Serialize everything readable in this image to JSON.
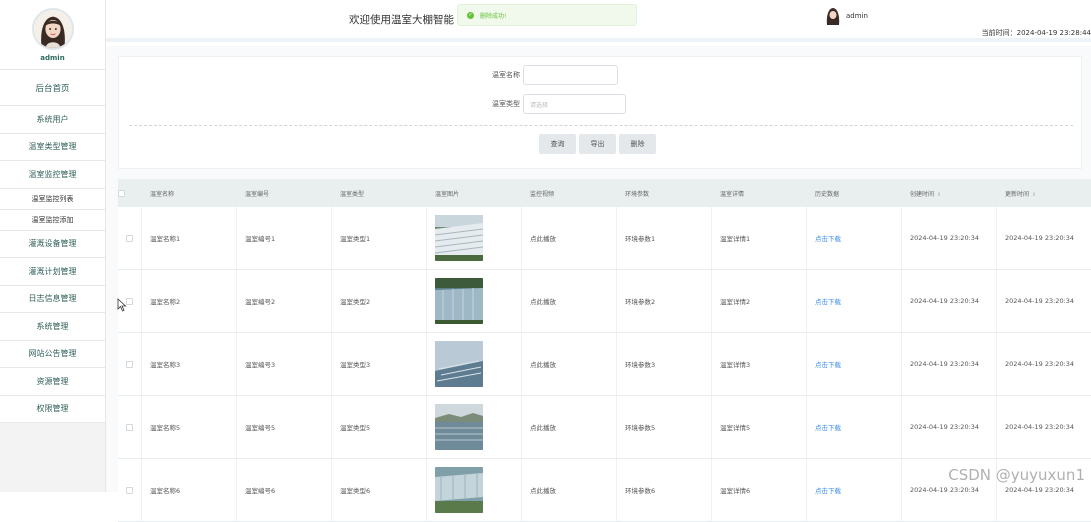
{
  "sidebar": {
    "user_name": "admin",
    "items": [
      {
        "label": "后台首页"
      },
      {
        "label": "系统用户"
      },
      {
        "label": "温室类型管理"
      },
      {
        "label": "温室监控管理"
      },
      {
        "label": "温室监控列表"
      },
      {
        "label": "温室监控添加"
      },
      {
        "label": "灌溉设备管理"
      },
      {
        "label": "灌溉计划管理"
      },
      {
        "label": "日志信息管理"
      },
      {
        "label": "系统管理"
      },
      {
        "label": "网站公告管理"
      },
      {
        "label": "资源管理"
      },
      {
        "label": "权限管理"
      }
    ]
  },
  "header": {
    "welcome": "欢迎使用温室大棚智能",
    "toast": "删除成功!",
    "user_name": "admin",
    "clock": "当前时间：2024-04-19 23:28:44"
  },
  "search": {
    "name_label": "温室名称",
    "name_value": "",
    "type_label": "温室类型",
    "type_placeholder": "请选择",
    "query_button": "查询",
    "export_button": "导出",
    "delete_button": "删除"
  },
  "table": {
    "headers": [
      "温室名称",
      "温室编号",
      "温室类型",
      "温室图片",
      "监控视频",
      "环境参数",
      "温室详情",
      "历史数据",
      "创建时间",
      "更新时间"
    ],
    "rows": [
      {
        "name": "温室名称1",
        "code": "温室编号1",
        "type": "温室类型1",
        "video": "点此播放",
        "env": "环境参数1",
        "detail": "温室详情1",
        "history": "点击下载",
        "created": "2024-04-19 23:20:34",
        "updated": "2024-04-19 23:20:34"
      },
      {
        "name": "温室名称2",
        "code": "温室编号2",
        "type": "温室类型2",
        "video": "点此播放",
        "env": "环境参数2",
        "detail": "温室详情2",
        "history": "点击下载",
        "created": "2024-04-19 23:20:34",
        "updated": "2024-04-19 23:20:34"
      },
      {
        "name": "温室名称3",
        "code": "温室编号3",
        "type": "温室类型3",
        "video": "点此播放",
        "env": "环境参数3",
        "detail": "温室详情3",
        "history": "点击下载",
        "created": "2024-04-19 23:20:34",
        "updated": "2024-04-19 23:20:34"
      },
      {
        "name": "温室名称5",
        "code": "温室编号5",
        "type": "温室类型5",
        "video": "点此播放",
        "env": "环境参数5",
        "detail": "温室详情5",
        "history": "点击下载",
        "created": "2024-04-19 23:20:34",
        "updated": "2024-04-19 23:20:34"
      },
      {
        "name": "温室名称6",
        "code": "温室编号6",
        "type": "温室类型6",
        "video": "点此播放",
        "env": "环境参数6",
        "detail": "温室详情6",
        "history": "点击下载",
        "created": "2024-04-19 23:20:34",
        "updated": "2024-04-19 23:20:34"
      }
    ]
  },
  "watermark": "CSDN @yuyuxun1",
  "colors": {
    "accent": "#2f5f58",
    "link": "#3a8ee6",
    "toast_bg": "#f0f9eb",
    "toast_text": "#67c23a"
  }
}
